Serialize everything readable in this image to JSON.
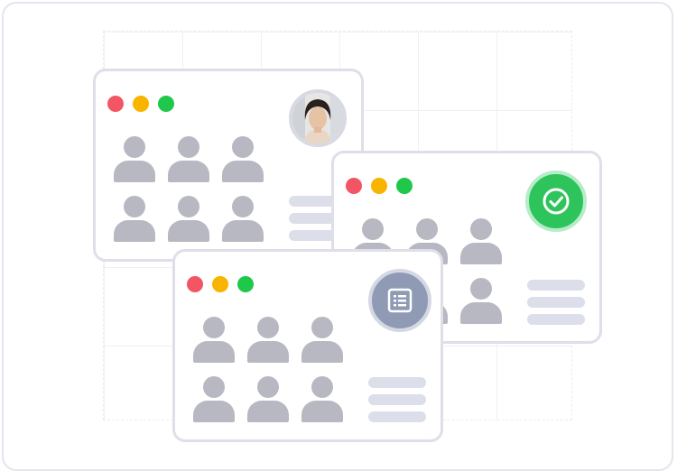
{
  "windows": [
    {
      "badge": "user-photo-avatar",
      "badge_color": "#e9e9ec"
    },
    {
      "badge": "check-icon",
      "badge_color": "#2dc45c"
    },
    {
      "badge": "document-list-icon",
      "badge_color": "#8f9bb5"
    }
  ],
  "colors": {
    "window_border": "#dedfe9",
    "dot_red": "#f25563",
    "dot_yellow": "#f9b400",
    "dot_green": "#1fc84a",
    "person_placeholder": "#b7b8c1",
    "text_placeholder": "#dcdee9"
  }
}
